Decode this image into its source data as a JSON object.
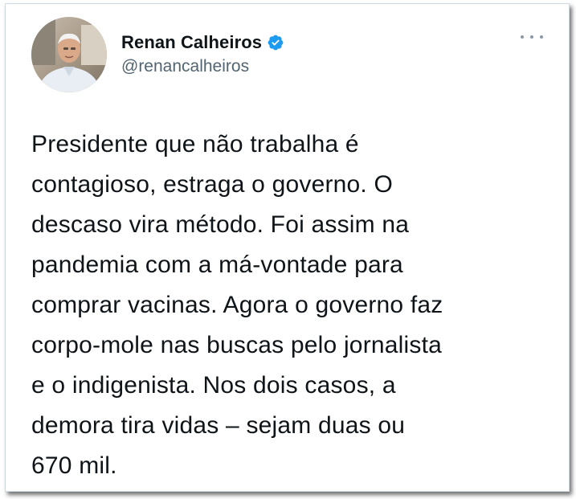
{
  "author": {
    "display_name": "Renan Calheiros",
    "handle": "@renancalheiros",
    "verified": true
  },
  "tweet": {
    "text": "Presidente que não trabalha é\ncontagioso, estraga o governo. O\ndescaso vira método. Foi assim na\npandemia com a má-vontade para\ncomprar vacinas. Agora o governo faz\ncorpo-mole nas buscas pelo jornalista\ne o indigenista. Nos dois casos, a\ndemora tira vidas – sejam duas ou\n670 mil."
  },
  "icons": {
    "verified": "verified-badge-icon",
    "more": "more-options-icon"
  },
  "colors": {
    "text": "#0f1419",
    "secondary": "#536471",
    "verified": "#1d9bf0",
    "border": "#cfd9de"
  }
}
